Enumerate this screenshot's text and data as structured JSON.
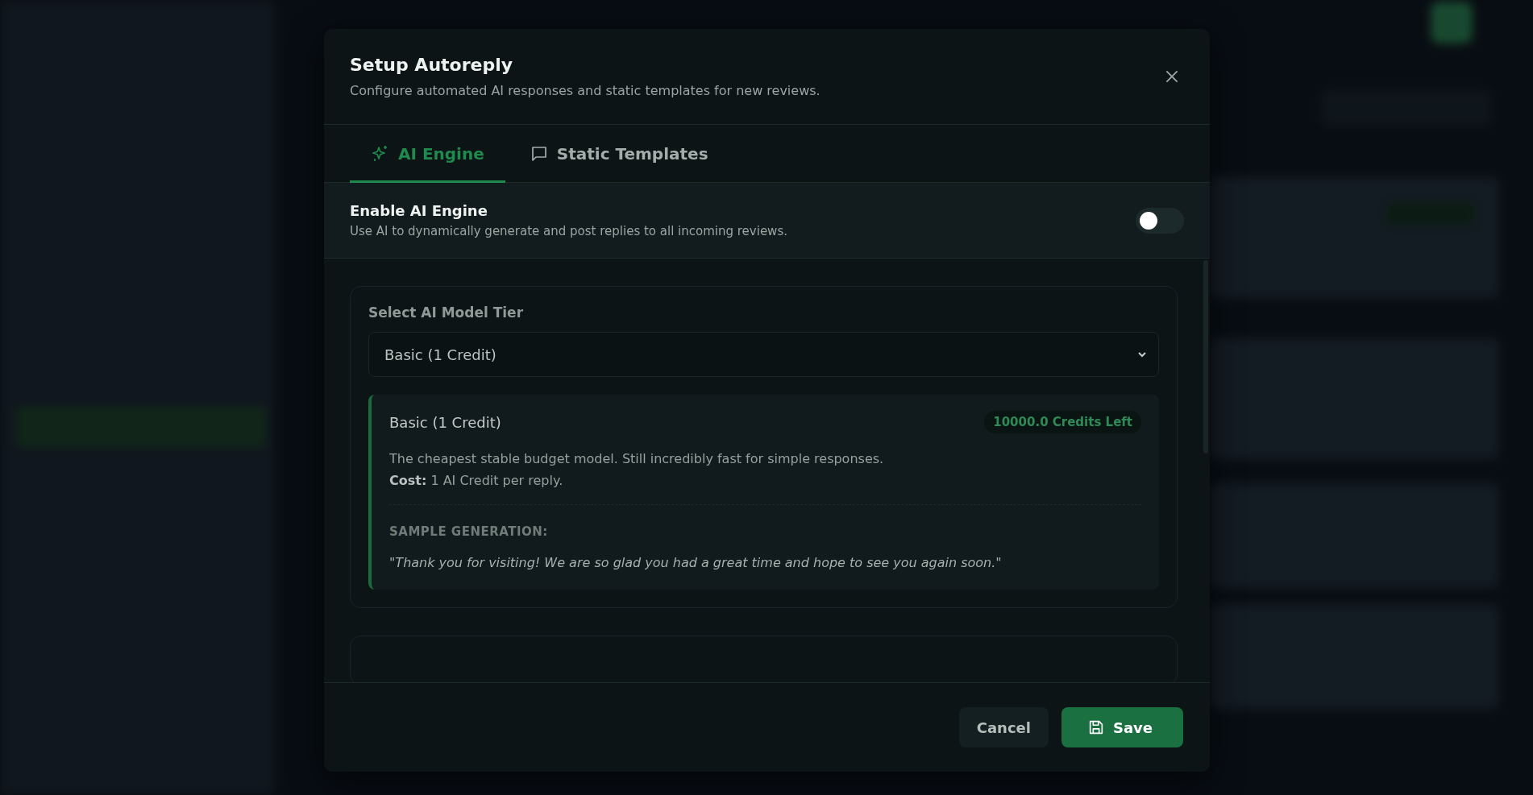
{
  "dialog": {
    "title": "Setup Autoreply",
    "subtitle": "Configure automated AI responses and static templates for new reviews."
  },
  "tabs": [
    {
      "label": "AI Engine",
      "selected": true
    },
    {
      "label": "Static Templates",
      "selected": false
    }
  ],
  "enable_ai": {
    "label": "Enable AI Engine",
    "description": "Use AI to dynamically generate and post replies to all incoming reviews.",
    "on": false
  },
  "model_tier": {
    "label": "Select AI Model Tier",
    "value": "Basic (1 Credit)"
  },
  "model_card": {
    "name": "Basic (1 Credit)",
    "badge": "10000.0 Credits Left",
    "description": "The cheapest stable budget model. Still incredibly fast for simple responses.",
    "cost": "**Cost:** 1 AI Credit per reply.",
    "sample_label": "SAMPLE GENERATION:",
    "sample": "\"Thank you for visiting! We are so glad you had a great time and hope to see you again soon.\""
  },
  "buttons": [
    {
      "label": "Cancel",
      "kind": "secondary"
    },
    {
      "label": "Save",
      "kind": "primary"
    }
  ]
}
